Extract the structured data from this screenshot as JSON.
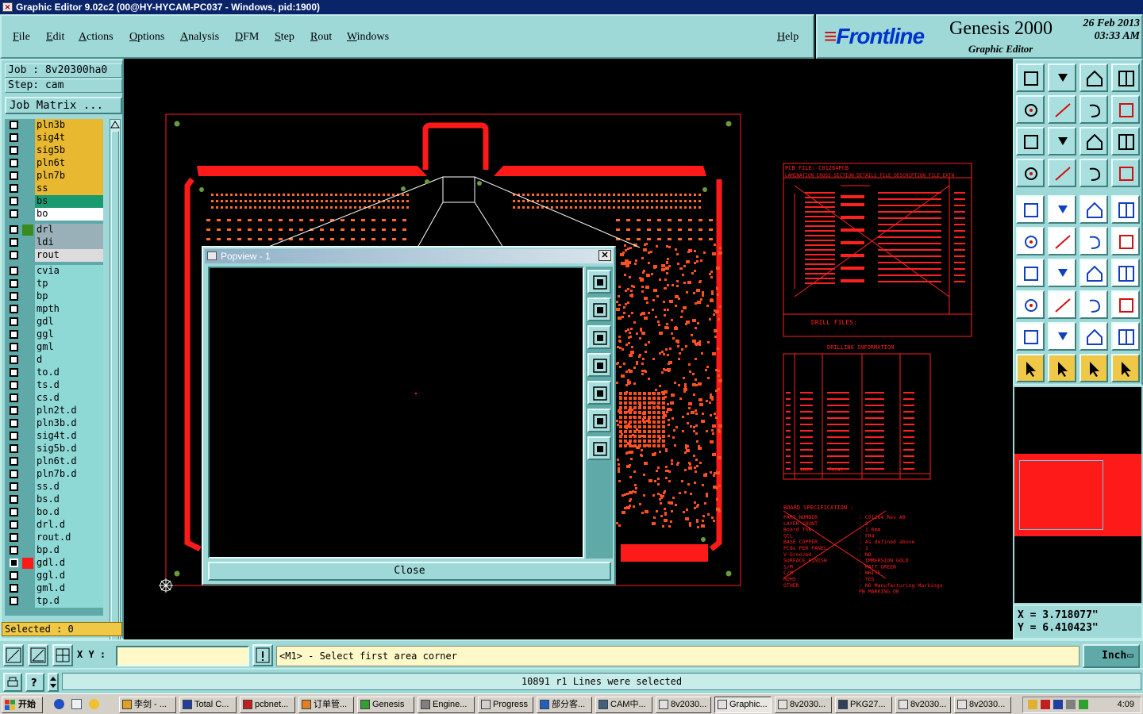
{
  "window": {
    "title": "Graphic Editor 9.02c2 (00@HY-HYCAM-PC037 - Windows, pid:1900)"
  },
  "menu": {
    "items": [
      "File",
      "Edit",
      "Actions",
      "Options",
      "Analysis",
      "DFM",
      "Step",
      "Rout",
      "Windows"
    ],
    "help": "Help"
  },
  "brand": {
    "logo": "Frontline",
    "product": "Genesis 2000",
    "subtitle": "Graphic Editor",
    "date": "26 Feb 2013",
    "time": "03:33 AM"
  },
  "job": {
    "job_label": "Job : 8v20300ha0",
    "step_label": "Step: cam",
    "matrix_button": "Job Matrix ..."
  },
  "layers": [
    {
      "name": "pln3b",
      "color": "#e8b830"
    },
    {
      "name": "sig4t",
      "color": "#e8b830"
    },
    {
      "name": "sig5b",
      "color": "#e8b830"
    },
    {
      "name": "pln6t",
      "color": "#e8b830"
    },
    {
      "name": "pln7b",
      "color": "#e8b830"
    },
    {
      "name": "ss",
      "color": "#e8b830"
    },
    {
      "name": "bs",
      "color": "#1a9a70"
    },
    {
      "name": "bo",
      "color": "#ffffff"
    },
    {
      "name": "drl",
      "color": "#9ab0b8",
      "swatch": "#3a8a20"
    },
    {
      "name": "ldi",
      "color": "#9ab0b8"
    },
    {
      "name": "rout",
      "color": "#dcdcdc"
    },
    {
      "name": "cvia",
      "color": "#8ed8d6"
    },
    {
      "name": "tp",
      "color": "#8ed8d6"
    },
    {
      "name": "bp",
      "color": "#8ed8d6"
    },
    {
      "name": "mpth",
      "color": "#8ed8d6"
    },
    {
      "name": "gdl",
      "color": "#8ed8d6"
    },
    {
      "name": "ggl",
      "color": "#8ed8d6"
    },
    {
      "name": "gml",
      "color": "#8ed8d6"
    },
    {
      "name": "d",
      "color": "#8ed8d6"
    },
    {
      "name": "to.d",
      "color": "#8ed8d6"
    },
    {
      "name": "ts.d",
      "color": "#8ed8d6"
    },
    {
      "name": "cs.d",
      "color": "#8ed8d6"
    },
    {
      "name": "pln2t.d",
      "color": "#8ed8d6"
    },
    {
      "name": "pln3b.d",
      "color": "#8ed8d6"
    },
    {
      "name": "sig4t.d",
      "color": "#8ed8d6"
    },
    {
      "name": "sig5b.d",
      "color": "#8ed8d6"
    },
    {
      "name": "pln6t.d",
      "color": "#8ed8d6"
    },
    {
      "name": "pln7b.d",
      "color": "#8ed8d6"
    },
    {
      "name": "ss.d",
      "color": "#8ed8d6"
    },
    {
      "name": "bs.d",
      "color": "#8ed8d6"
    },
    {
      "name": "bo.d",
      "color": "#8ed8d6"
    },
    {
      "name": "drl.d",
      "color": "#8ed8d6"
    },
    {
      "name": "rout.d",
      "color": "#8ed8d6"
    },
    {
      "name": "bp.d",
      "color": "#8ed8d6"
    },
    {
      "name": "gdl.d",
      "color": "#8ed8d6",
      "swatch": "#ff1a1a",
      "active": true
    },
    {
      "name": "ggl.d",
      "color": "#8ed8d6"
    },
    {
      "name": "gml.d",
      "color": "#8ed8d6"
    },
    {
      "name": "tp.d",
      "color": "#8ed8d6"
    }
  ],
  "selected_label": "Selected : 0",
  "popview": {
    "title": "Popview - 1",
    "close_button": "Close"
  },
  "coords": {
    "x": "X = 3.718077\"",
    "y": "Y = 6.410423\""
  },
  "command": {
    "xy_label": "X Y :",
    "xy_value": "",
    "prompt": "<M1> - Select first area corner",
    "units": "Inch"
  },
  "status": {
    "message": "10891 r1 Lines were selected"
  },
  "taskbar": {
    "start": "开始",
    "tasks": [
      "李剑 - ...",
      "Total C...",
      "pcbnet...",
      "订单管...",
      "Genesis",
      "Engine...",
      "Progress",
      "部分客...",
      "CAM中...",
      "8v2030...",
      "Graphic...",
      "8v2030...",
      "PKG27...",
      "8v2030...",
      "8v2030..."
    ],
    "active_index": 10,
    "clock": "4:09"
  },
  "drawing": {
    "stackup_title": "PCB FILE: C01264PCB",
    "stackup_header": "LAMINATION CROSS SECTION DETAILS     FILE DESCRIPTION     FILE EXTN",
    "drill_files_label": "DRILL FILES:",
    "drill_info_title": "DRILLING INFORMATION",
    "drill_total": "1820",
    "drill_total_label": "Total",
    "board_spec_title": "BOARD SPECIFICATION :",
    "board_spec": [
      [
        "PART NUMBER",
        ": C01264  Rev A0"
      ],
      [
        "LAYER COUNT",
        ": 8"
      ],
      [
        "Board Thk",
        ": 1.6mm"
      ],
      [
        "CCL",
        ": FR4"
      ],
      [
        "BASE COPPER",
        ": As defined above"
      ],
      [
        "PCBs PER PANEL",
        ": 1"
      ],
      [
        "V-Grooved",
        ": NO"
      ],
      [
        "SURFACE FINISH",
        ": IMMERSION GOLD"
      ],
      [
        "S/M",
        ": MATT GREEN"
      ],
      [
        "C/M",
        ": WHITE"
      ],
      [
        "ROHS",
        ": YES"
      ],
      [
        "OTHER",
        ": NO Manufacturing Markings"
      ],
      [
        "",
        "  PB MARKING OK"
      ]
    ]
  }
}
